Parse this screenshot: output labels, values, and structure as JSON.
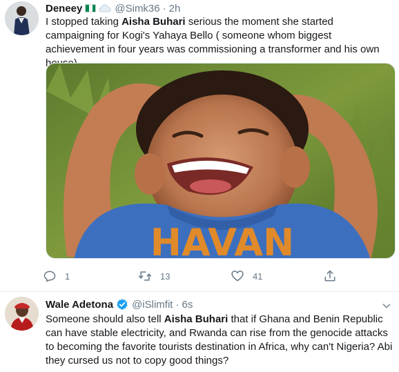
{
  "tweets": [
    {
      "name": "Deneey",
      "handle": "@Simk36",
      "separator": "·",
      "time": "2h",
      "text_parts": [
        {
          "t": "I stopped taking ",
          "bold": false
        },
        {
          "t": "Aisha Buhari",
          "bold": true
        },
        {
          "t": " serious the moment she started campaigning for Kogi's Yahaya Bello ( someone whom biggest achievement in four years was commissioning a transformer and his own house)",
          "bold": false
        }
      ],
      "actions": {
        "reply_count": "1",
        "retweet_count": "13",
        "like_count": "41"
      }
    },
    {
      "name": "Wale Adetona",
      "handle": "@iSlimfit",
      "separator": "·",
      "time": "6s",
      "text_parts": [
        {
          "t": "Someone should also tell ",
          "bold": false
        },
        {
          "t": "Aisha Buhari",
          "bold": true
        },
        {
          "t": " that if Ghana and Benin Republic can have stable electricity, and Rwanda can rise from the genocide attacks to becoming the favorite tourists destination in Africa, why can't Nigeria? Abi they cursed us not to copy good things?",
          "bold": false
        }
      ]
    }
  ],
  "photo_text": "HAVAN",
  "icons": {
    "reply": "reply-icon",
    "retweet": "retweet-icon",
    "like": "heart-icon",
    "share": "share-icon",
    "more": "chevron-down-icon",
    "verified": "verified-badge-icon",
    "flag": "nigeria-flag-icon"
  },
  "colors": {
    "text": "#14171a",
    "secondary": "#657786",
    "verified": "#1da1f2",
    "divider": "#e6ecf0"
  }
}
